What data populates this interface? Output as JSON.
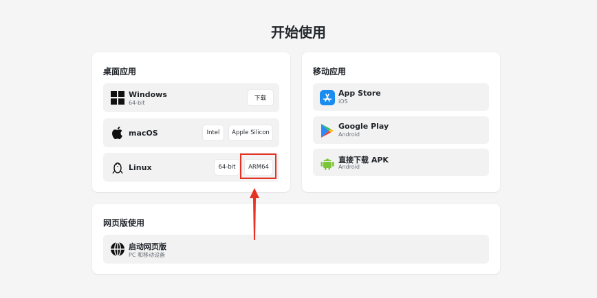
{
  "page": {
    "title": "开始使用"
  },
  "desktop": {
    "title": "桌面应用",
    "items": [
      {
        "name": "Windows",
        "sub": "64-bit",
        "icon": "windows-icon",
        "buttons": [
          "下载"
        ]
      },
      {
        "name": "macOS",
        "sub": "",
        "icon": "apple-icon",
        "buttons": [
          "Intel",
          "Apple Silicon"
        ]
      },
      {
        "name": "Linux",
        "sub": "",
        "icon": "linux-icon",
        "buttons": [
          "64-bit",
          "ARM64"
        ]
      }
    ]
  },
  "mobile": {
    "title": "移动应用",
    "items": [
      {
        "name": "App Store",
        "sub": "iOS",
        "icon": "app-store-icon"
      },
      {
        "name": "Google Play",
        "sub": "Android",
        "icon": "google-play-icon"
      },
      {
        "name": "直接下载 APK",
        "sub": "Android",
        "icon": "android-icon"
      }
    ]
  },
  "web": {
    "title": "网页版使用",
    "items": [
      {
        "name": "启动网页版",
        "sub": "PC 和移动设备",
        "icon": "globe-icon"
      }
    ]
  },
  "annotation": {
    "color": "#e53223",
    "target": "ARM64"
  },
  "colors": {
    "background": "#f5f5f6",
    "card": "#ffffff",
    "row": "#f2f2f3",
    "accent": "#e53223"
  }
}
